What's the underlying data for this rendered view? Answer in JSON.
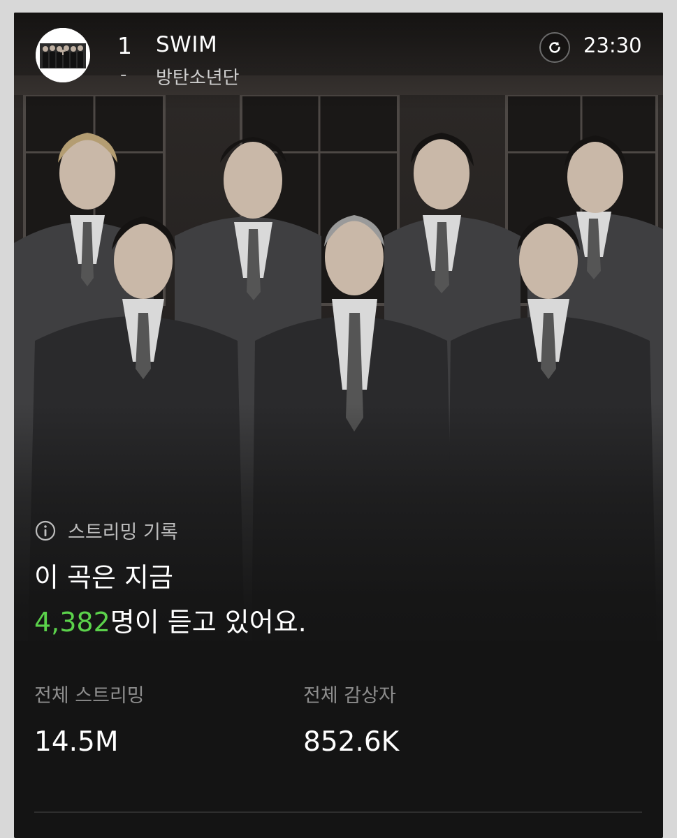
{
  "header": {
    "rank": "1",
    "rank_change": "-",
    "song_title": "SWIM",
    "artist": "방탄소년단",
    "time": "23:30"
  },
  "icons": {
    "refresh": "refresh-icon",
    "info": "info-icon"
  },
  "streaming": {
    "section_label": "스트리밍 기록",
    "line1": "이 곡은 지금",
    "listeners_now": "4,382",
    "line2_suffix": "명이 듣고 있어요.",
    "accent_color": "#5bd24b"
  },
  "stats": {
    "total_streams_label": "전체 스트리밍",
    "total_streams_value": "14.5M",
    "total_listeners_label": "전체 감상자",
    "total_listeners_value": "852.6K"
  }
}
